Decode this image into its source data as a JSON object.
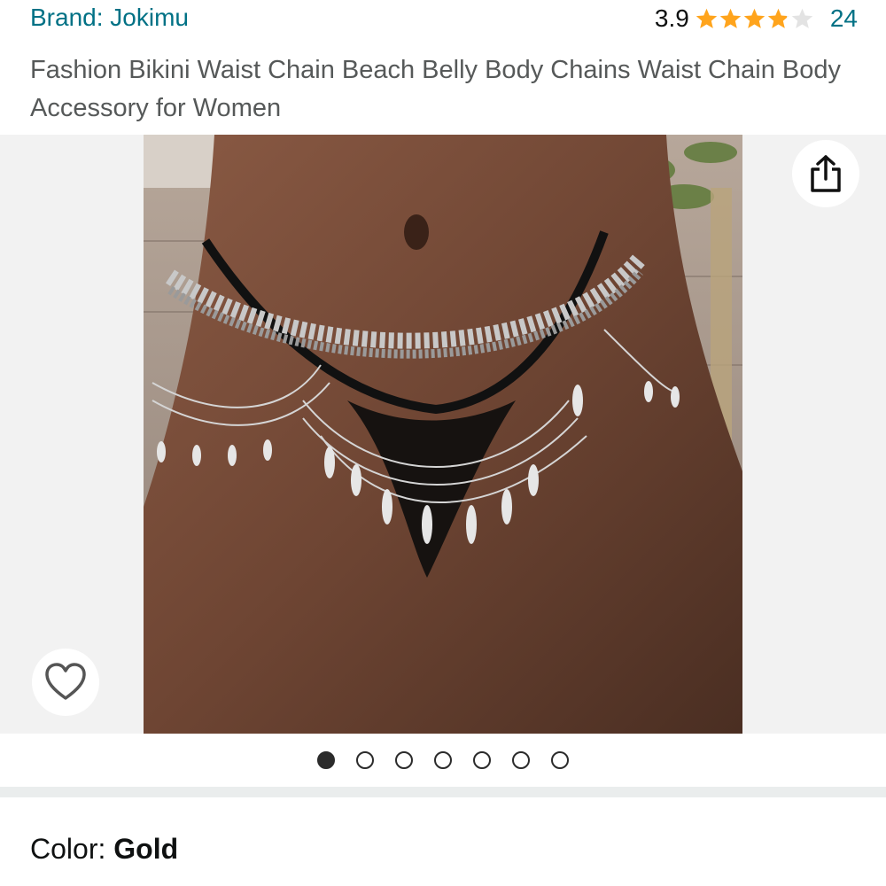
{
  "brand": {
    "label": "Brand: Jokimu"
  },
  "rating": {
    "value": "3.9",
    "stars": 3.9,
    "max_stars": 5,
    "count": "24",
    "star_color": "#ffa41c",
    "empty_star_color": "#e3e3e3"
  },
  "product": {
    "title": "Fashion Bikini Waist Chain Beach Belly Body Chains Waist Chain Body Accessory for Women"
  },
  "gallery": {
    "image_count": 7,
    "active_index": 0
  },
  "icons": {
    "share": "share-icon",
    "wishlist": "heart-icon"
  },
  "color": {
    "label": "Color: ",
    "value": "Gold"
  },
  "colors": {
    "link": "#007185",
    "text": "#0f1111",
    "muted": "#565959",
    "gallery_bg": "#f2f2f2"
  }
}
